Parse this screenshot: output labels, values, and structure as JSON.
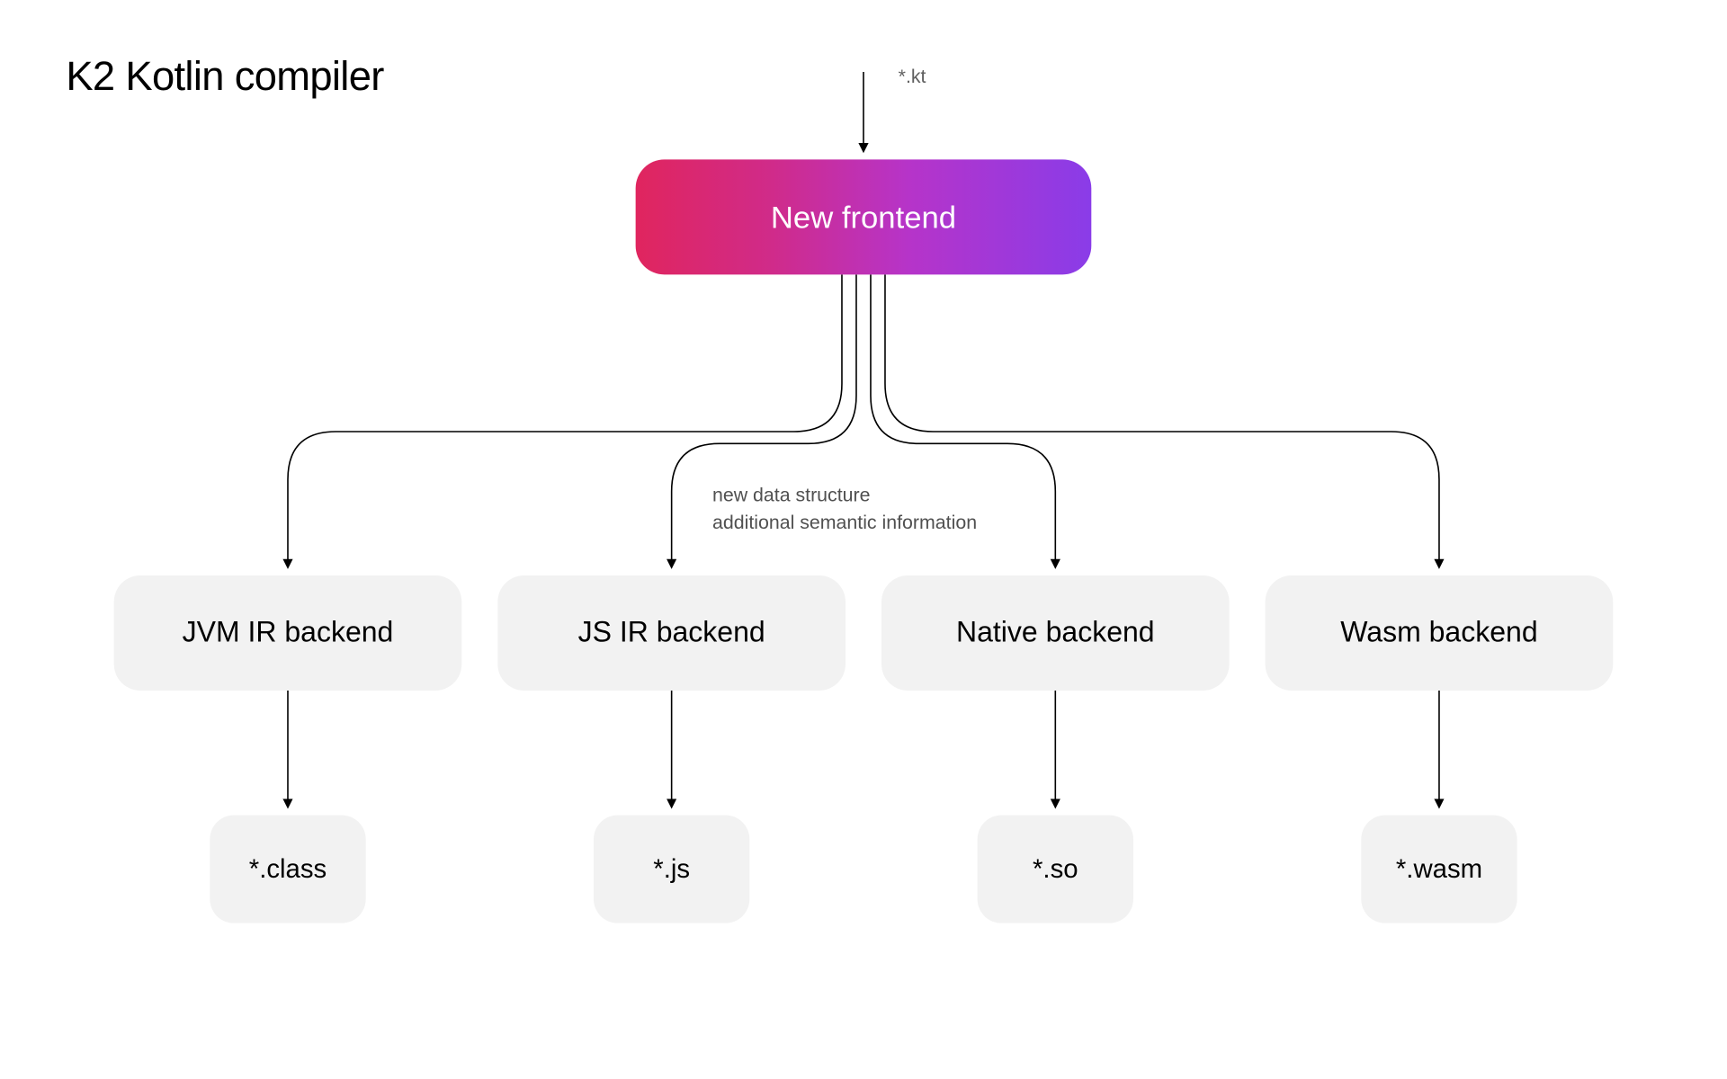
{
  "title": "K2 Kotlin compiler",
  "input_ext": "*.kt",
  "frontend_label": "New frontend",
  "annotation_line1": "new data structure",
  "annotation_line2": "additional semantic information",
  "backends": [
    {
      "label": "JVM IR backend",
      "output": "*.class"
    },
    {
      "label": "JS IR backend",
      "output": "*.js"
    },
    {
      "label": "Native backend",
      "output": "*.so"
    },
    {
      "label": "Wasm backend",
      "output": "*.wasm"
    }
  ],
  "colors": {
    "gradient_start": "#e0255e",
    "gradient_end": "#8a3ce8",
    "node_fill": "#f2f2f2"
  },
  "chart_data": {
    "type": "flow-diagram",
    "input": "*.kt",
    "stage": "New frontend",
    "edge_label": [
      "new data structure",
      "additional semantic information"
    ],
    "branches": [
      {
        "backend": "JVM IR backend",
        "output": "*.class"
      },
      {
        "backend": "JS IR backend",
        "output": "*.js"
      },
      {
        "backend": "Native backend",
        "output": "*.so"
      },
      {
        "backend": "Wasm backend",
        "output": "*.wasm"
      }
    ]
  }
}
